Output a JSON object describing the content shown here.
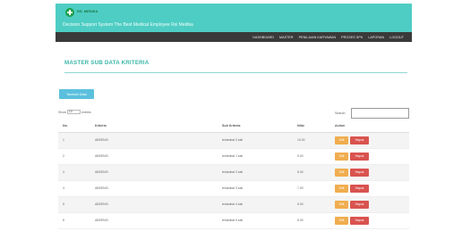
{
  "header": {
    "brand": "RS. MEDIKA",
    "tagline": "Decision Support System The Best Medical Employee Rsi Medika"
  },
  "nav": [
    {
      "label": "DASHBOARD"
    },
    {
      "label": "MASTER"
    },
    {
      "label": "PENILAIAN KARYAWAN"
    },
    {
      "label": "PROSES SPK"
    },
    {
      "label": "LAPORAN"
    },
    {
      "label": "LOGOUT"
    }
  ],
  "page": {
    "title": "MASTER SUB DATA KRITERIA",
    "add_button": "Tambah Data"
  },
  "table_controls": {
    "show_label": "Show",
    "length_value": "10",
    "entries_label": "entries",
    "search_label": "Search:"
  },
  "table": {
    "columns": [
      "No.",
      "Kriteria",
      "Sub Kriteria",
      "Nilai",
      "Action"
    ],
    "rows": [
      {
        "no": "1",
        "kriteria": "ABSENSI",
        "sub": "terlambat 0 kali",
        "nilai": "10.00"
      },
      {
        "no": "2",
        "kriteria": "ABSENSI",
        "sub": "terlambat 1 kali",
        "nilai": "9.00"
      },
      {
        "no": "3",
        "kriteria": "ABSENSI",
        "sub": "terlambat 2 kali",
        "nilai": "8.00"
      },
      {
        "no": "4",
        "kriteria": "ABSENSI",
        "sub": "terlambat 3 kali",
        "nilai": "7.00"
      },
      {
        "no": "5",
        "kriteria": "ABSENSI",
        "sub": "terlambat 4 kali",
        "nilai": "6.00"
      },
      {
        "no": "6",
        "kriteria": "ABSENSI",
        "sub": "terlambat 5 kali",
        "nilai": "5.00"
      }
    ],
    "edit_label": "Edit",
    "delete_label": "Hapus"
  },
  "colors": {
    "brand_teal": "#4ecdc4",
    "nav_dark": "#3a3a3a",
    "title_teal": "#3ab5a8",
    "edit": "#f0ad4e",
    "delete": "#d9534f",
    "add": "#5bc0de"
  },
  "icons": {
    "logo": "medical-cross-icon"
  }
}
